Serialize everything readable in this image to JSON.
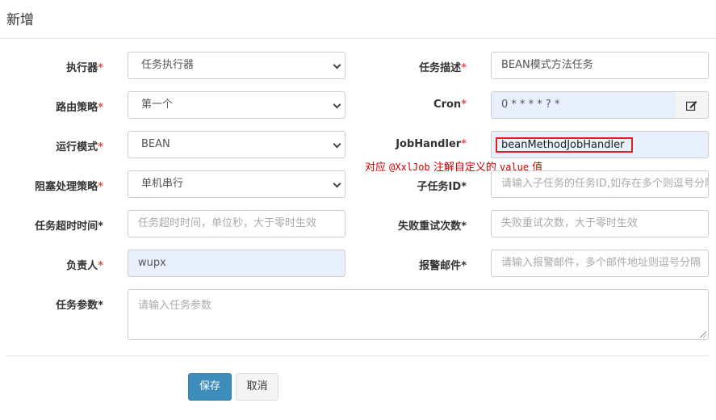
{
  "modal": {
    "title": "新增"
  },
  "form": {
    "executor": {
      "label": "执行器",
      "value": "任务执行器"
    },
    "job_desc": {
      "label": "任务描述",
      "value": "BEAN模式方法任务"
    },
    "route_strategy": {
      "label": "路由策略",
      "value": "第一个"
    },
    "cron": {
      "label": "Cron",
      "value": "0 * * * * ? *"
    },
    "run_mode": {
      "label": "运行模式",
      "value": "BEAN"
    },
    "job_handler": {
      "label": "JobHandler",
      "value": "beanMethodJobHandler"
    },
    "block_strategy": {
      "label": "阻塞处理策略",
      "value": "单机串行"
    },
    "child_job_id": {
      "label": "子任务ID",
      "placeholder": "请输入子任务的任务ID,如存在多个则逗号分隔"
    },
    "timeout": {
      "label": "任务超时时间",
      "placeholder": "任务超时时间，单位秒，大于零时生效"
    },
    "fail_retry": {
      "label": "失败重试次数",
      "placeholder": "失败重试次数，大于零时生效"
    },
    "author": {
      "label": "负责人",
      "value": "wupx"
    },
    "alarm_email": {
      "label": "报警邮件",
      "placeholder": "请输入报警邮件，多个邮件地址则逗号分隔"
    },
    "job_param": {
      "label": "任务参数",
      "placeholder": "请输入任务参数"
    },
    "required_mark": "*"
  },
  "annotation": {
    "prefix": "对应 ",
    "code1": "@XxlJob",
    "middle": " 注解自定义的 ",
    "code2": "value",
    "suffix": " 值"
  },
  "buttons": {
    "save": "保存",
    "cancel": "取消"
  },
  "icons": {
    "cron_edit": "edit-icon",
    "select_arrow": "chevron-down-icon"
  },
  "colors": {
    "primary": "#3c8dbc",
    "required": "#d9534f",
    "annotation": "#d00000",
    "autofill": "#e8f0fe"
  }
}
